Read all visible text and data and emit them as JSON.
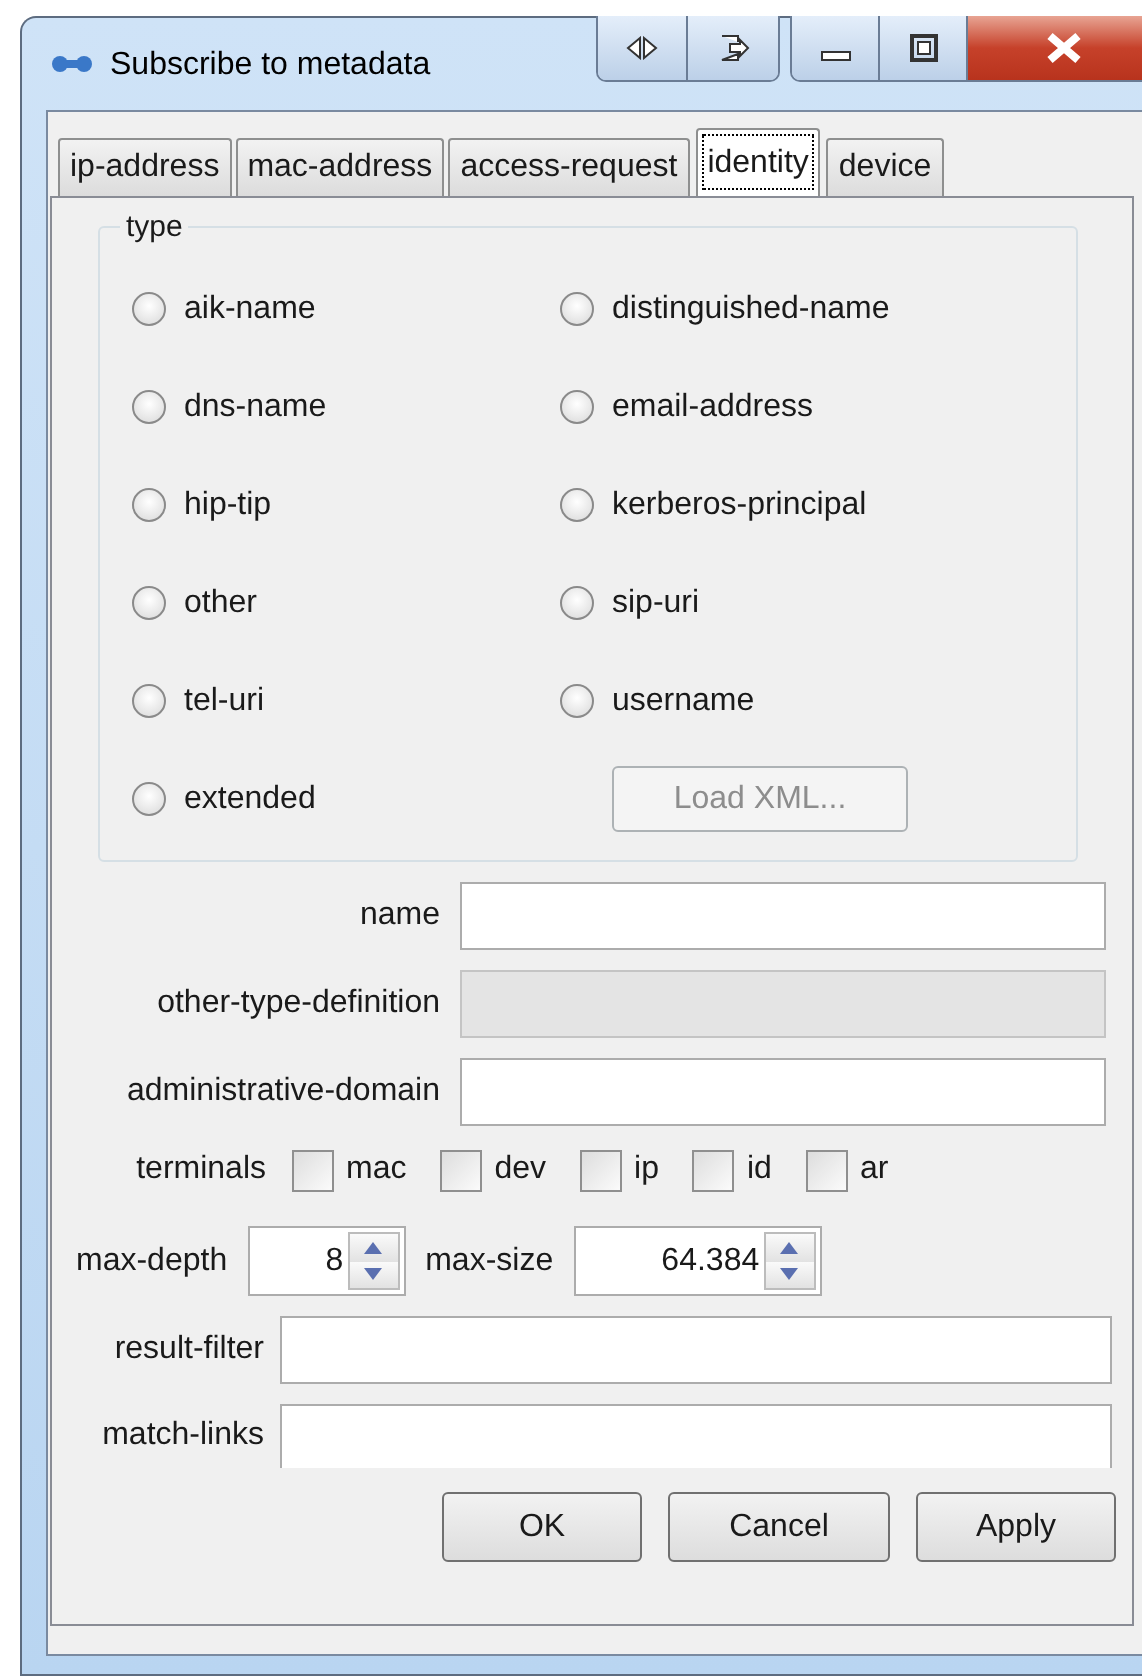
{
  "window": {
    "title": "Subscribe to metadata"
  },
  "tabs": [
    {
      "label": "ip-address",
      "selected": false
    },
    {
      "label": "mac-address",
      "selected": false
    },
    {
      "label": "access-request",
      "selected": false
    },
    {
      "label": "identity",
      "selected": true
    },
    {
      "label": "device",
      "selected": false
    }
  ],
  "type_group": {
    "title": "type",
    "options": [
      {
        "label": "aik-name",
        "selected": false
      },
      {
        "label": "distinguished-name",
        "selected": false
      },
      {
        "label": "dns-name",
        "selected": false
      },
      {
        "label": "email-address",
        "selected": false
      },
      {
        "label": "hip-tip",
        "selected": false
      },
      {
        "label": "kerberos-principal",
        "selected": false
      },
      {
        "label": "other",
        "selected": false
      },
      {
        "label": "sip-uri",
        "selected": false
      },
      {
        "label": "tel-uri",
        "selected": false
      },
      {
        "label": "username",
        "selected": false
      },
      {
        "label": "extended",
        "selected": false
      }
    ],
    "load_button": {
      "label": "Load XML...",
      "disabled": true
    }
  },
  "fields": [
    {
      "label": "name",
      "disabled": false
    },
    {
      "label": "other-type-definition",
      "disabled": true
    },
    {
      "label": "administrative-domain",
      "disabled": false
    }
  ],
  "terminals": {
    "label": "terminals",
    "options": [
      {
        "label": "mac",
        "checked": false
      },
      {
        "label": "dev",
        "checked": false
      },
      {
        "label": "ip",
        "checked": false
      },
      {
        "label": "id",
        "checked": false
      },
      {
        "label": "ar",
        "checked": false
      }
    ]
  },
  "spinners": [
    {
      "label": "max-depth",
      "value": "8"
    },
    {
      "label": "max-size",
      "value": "64.384"
    }
  ],
  "filters": [
    {
      "label": "result-filter",
      "disabled": false
    },
    {
      "label": "match-links",
      "disabled": false
    }
  ],
  "buttons": [
    "OK",
    "Cancel",
    "Apply"
  ]
}
